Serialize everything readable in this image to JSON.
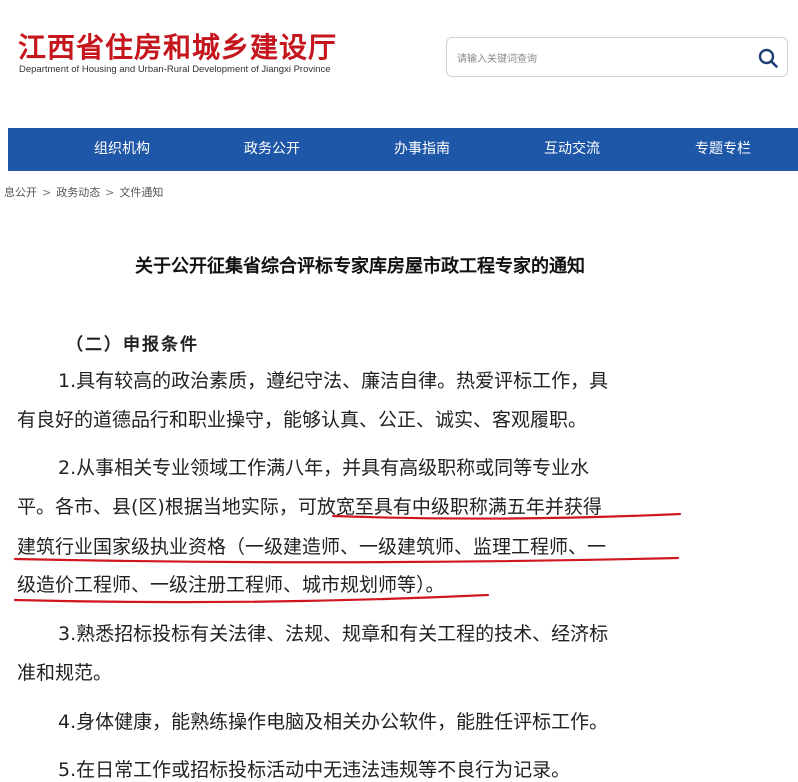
{
  "header": {
    "title_cn": "江西省住房和城乡建设厅",
    "title_en": "Department of Housing and Urban-Rural Development of Jiangxi Province"
  },
  "search": {
    "placeholder": "请输入关键词查询",
    "icon": "search-icon"
  },
  "nav": {
    "items": [
      "组织机构",
      "政务公开",
      "办事指南",
      "互动交流",
      "专题专栏"
    ],
    "color": "#1f57a8"
  },
  "breadcrumb": {
    "items": [
      "息公开",
      "政务动态",
      "文件通知"
    ],
    "separator": ">"
  },
  "article": {
    "title": "关于公开征集省综合评标专家库房屋市政工程专家的通知",
    "section_heading": "（二）申报条件",
    "lines": [
      "1.具有较高的政治素质，遵纪守法、廉洁自律。热爱评标工作，具",
      "有良好的道德品行和职业操守，能够认真、公正、诚实、客观履职。",
      "2.从事相关专业领域工作满八年，并具有高级职称或同等专业水",
      "平。各市、县(区)根据当地实际，可放宽至具有中级职称满五年并获得",
      "建筑行业国家级执业资格（一级建造师、一级建筑师、监理工程师、一",
      "级造价工程师、一级注册工程师、城市规划师等）。",
      "3.熟悉招标投标有关法律、法规、规章和有关工程的技术、经济标",
      "准和规范。",
      "4.身体健康，能熟练操作电脑及相关办公软件，能胜任评标工作。",
      "5.在日常工作或招标投标活动中无违法违规等不良行为记录。"
    ]
  },
  "annotation_color": "#d0161e"
}
